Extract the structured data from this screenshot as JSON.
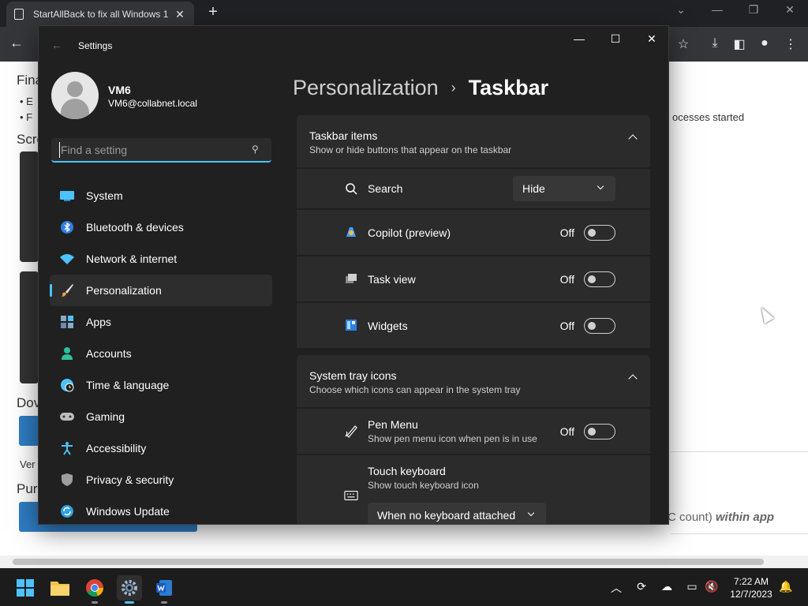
{
  "browser": {
    "tab_title": "StartAllBack to fix all Windows 1",
    "page_fragments": {
      "fina": "Fina",
      "b1": "E",
      "b2": "F",
      "scre": "Scre",
      "dov": "Dov",
      "ver": "Ver",
      "pur": "Pur",
      "processes": "ocesses started",
      "count_prefix": "C count)",
      "count_em": "within app"
    }
  },
  "settings": {
    "window_title": "Settings",
    "profile": {
      "name": "VM6",
      "email": "VM6@collabnet.local"
    },
    "search": {
      "placeholder": "Find a setting"
    },
    "nav": [
      {
        "label": "System",
        "icon": "monitor-icon",
        "active": false
      },
      {
        "label": "Bluetooth & devices",
        "icon": "bluetooth-icon",
        "active": false
      },
      {
        "label": "Network & internet",
        "icon": "wifi-icon",
        "active": false
      },
      {
        "label": "Personalization",
        "icon": "brush-icon",
        "active": true
      },
      {
        "label": "Apps",
        "icon": "apps-icon",
        "active": false
      },
      {
        "label": "Accounts",
        "icon": "person-icon",
        "active": false
      },
      {
        "label": "Time & language",
        "icon": "globe-clock-icon",
        "active": false
      },
      {
        "label": "Gaming",
        "icon": "gamepad-icon",
        "active": false
      },
      {
        "label": "Accessibility",
        "icon": "accessibility-icon",
        "active": false
      },
      {
        "label": "Privacy & security",
        "icon": "shield-icon",
        "active": false
      },
      {
        "label": "Windows Update",
        "icon": "update-icon",
        "active": false
      }
    ],
    "breadcrumb": {
      "parent": "Personalization",
      "sep": "›",
      "current": "Taskbar"
    },
    "taskbar_items": {
      "title": "Taskbar items",
      "subtitle": "Show or hide buttons that appear on the taskbar",
      "search": {
        "label": "Search",
        "value": "Hide"
      },
      "copilot": {
        "label": "Copilot (preview)",
        "state": "Off"
      },
      "taskview": {
        "label": "Task view",
        "state": "Off"
      },
      "widgets": {
        "label": "Widgets",
        "state": "Off"
      }
    },
    "system_tray": {
      "title": "System tray icons",
      "subtitle": "Choose which icons can appear in the system tray",
      "pen": {
        "label": "Pen Menu",
        "sub": "Show pen menu icon when pen is in use",
        "state": "Off"
      },
      "touch": {
        "label": "Touch keyboard",
        "sub": "Show touch keyboard icon",
        "value": "When no keyboard attached"
      }
    }
  },
  "taskbar": {
    "time": "7:22 AM",
    "date": "12/7/2023"
  },
  "colors": {
    "accent": "#4cc2ff",
    "window_bg": "#202020",
    "card_bg": "#2b2b2b"
  }
}
